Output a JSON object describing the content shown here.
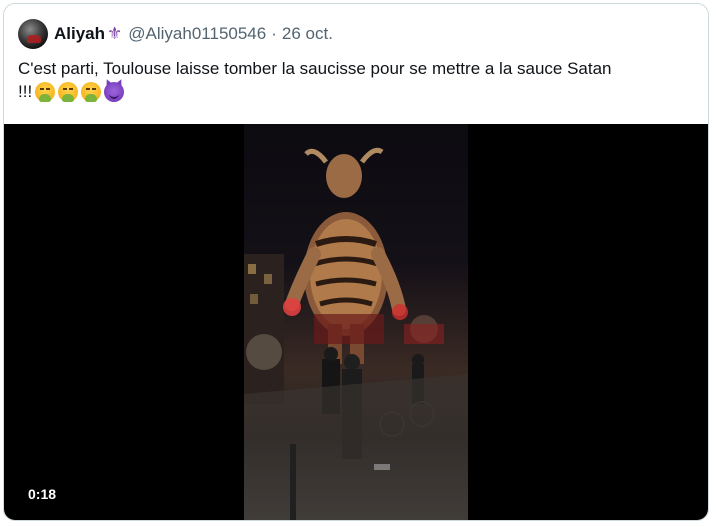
{
  "tweet": {
    "display_name": "Aliyah",
    "name_emoji": "⚜",
    "handle": "@Aliyah01150546",
    "separator": "·",
    "date": "26 oct.",
    "text": "C'est parti, Toulouse laisse tomber la saucisse pour se mettre a la sauce Satan",
    "exclamations": "!!!",
    "emojis": [
      "nauseated-face-vomiting",
      "nauseated-face-vomiting",
      "nauseated-face-vomiting",
      "smiling-face-with-horns"
    ]
  },
  "media": {
    "type": "video",
    "duration": "0:18"
  },
  "colors": {
    "text_primary": "#0f1419",
    "text_secondary": "#536471",
    "border": "#cfd9de",
    "video_bg": "#000000"
  }
}
